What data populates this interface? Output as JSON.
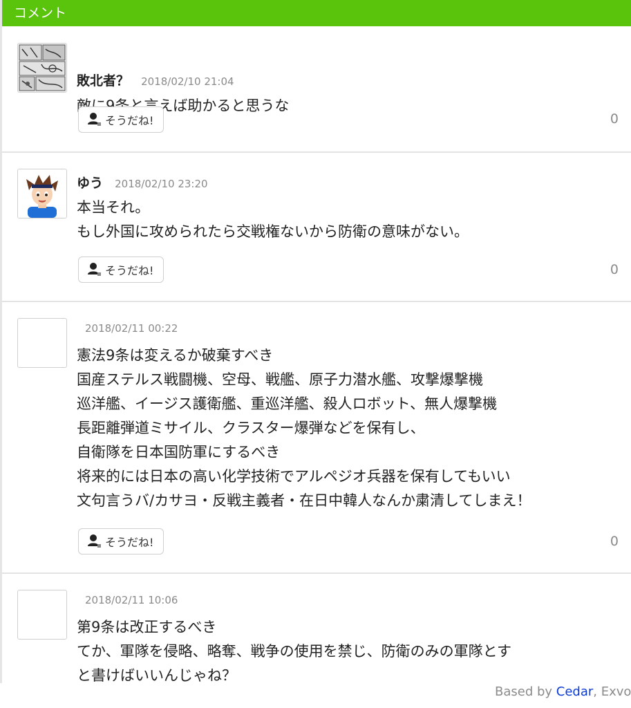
{
  "header": {
    "title": "コメント"
  },
  "like_label": "そうだね!",
  "comments": [
    {
      "author": "敗北者？",
      "date": "2018/02/10 21:04",
      "lines": [
        "敵に9条と言えば助かると思うな"
      ],
      "likes": "0",
      "avatar": "manga-collage"
    },
    {
      "author": "ゆう",
      "date": "2018/02/10 23:20",
      "lines": [
        "本当それ。",
        "もし外国に攻められたら交戦権ないから防衛の意味がない。"
      ],
      "likes": "0",
      "avatar": "mii-character"
    },
    {
      "author": "",
      "date": "2018/02/11 00:22",
      "lines": [
        "憲法9条は変えるか破棄すべき",
        "国産ステルス戦闘機、空母、戦艦、原子力潜水艦、攻撃爆撃機",
        "巡洋艦、イージス護衛艦、重巡洋艦、殺人ロボット、無人爆撃機",
        "長距離弾道ミサイル、クラスター爆弾などを保有し、",
        "自衛隊を日本国防軍にするべき",
        "将来的には日本の高い化学技術でアルペジオ兵器を保有してもいい",
        "文句言うバ/カサヨ・反戦主義者・在日中韓人なんか粛清してしまえ！"
      ],
      "likes": "0",
      "avatar": "blank"
    },
    {
      "author": "",
      "date": "2018/02/11 10:06",
      "lines": [
        "第9条は改正するべき",
        "てか、軍隊を侵略、略奪、戦争の使用を禁じ、防衛のみの軍隊とす",
        "と書けばいいんじゃね？"
      ],
      "likes": "",
      "avatar": "blank"
    }
  ],
  "footer": {
    "prefix": "Based by ",
    "link": "Cedar",
    "suffix": ", Exvo"
  }
}
